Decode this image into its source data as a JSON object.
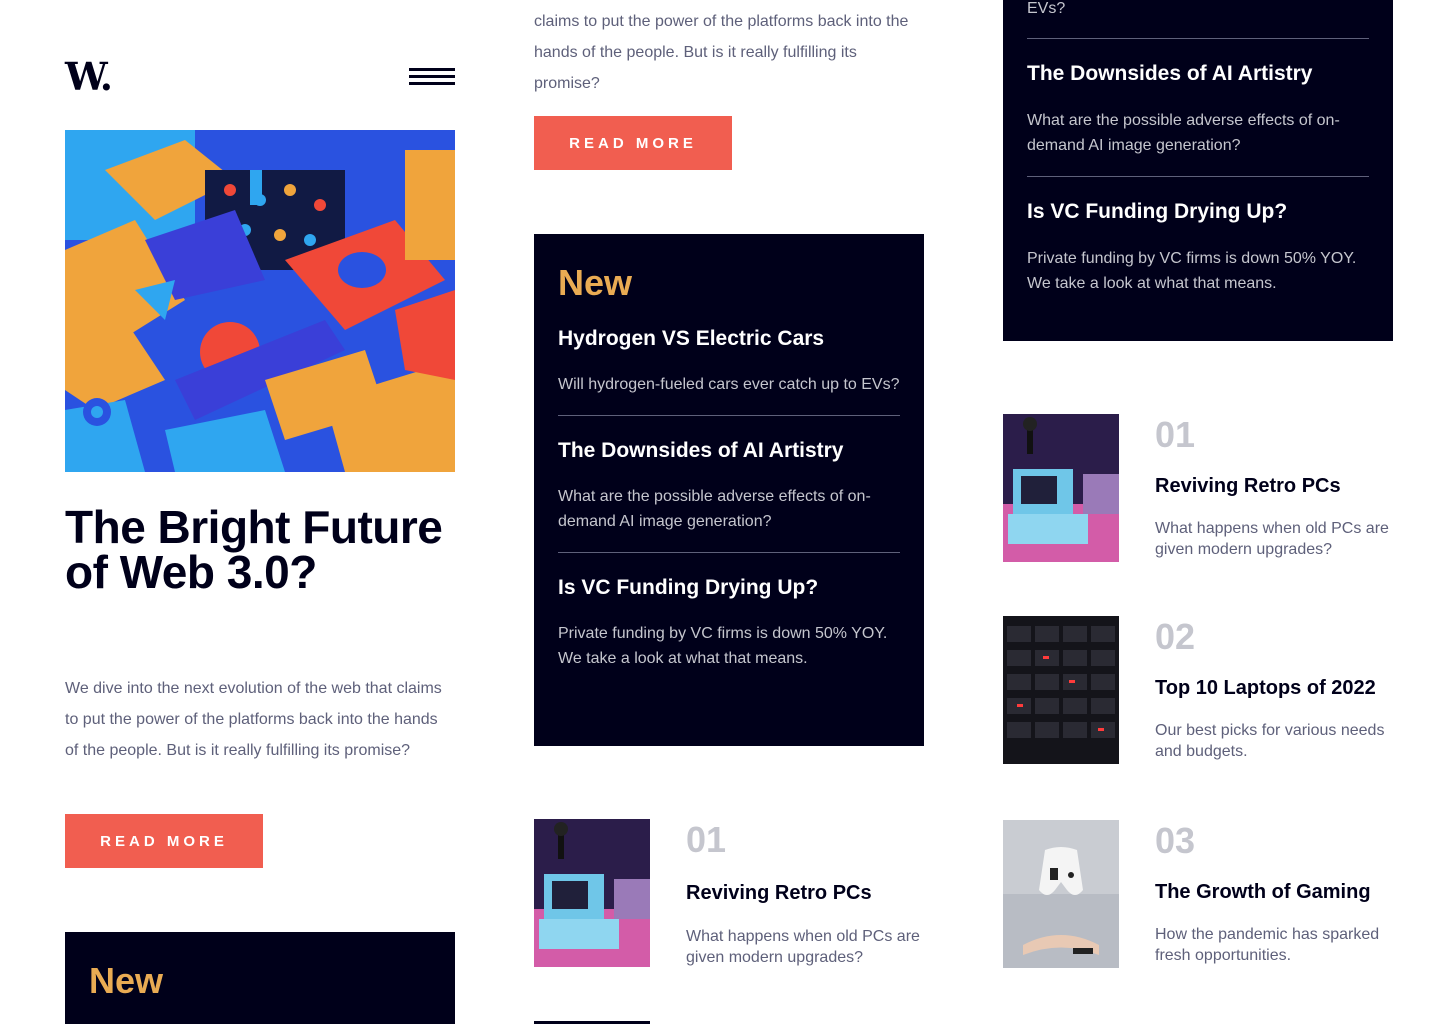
{
  "header": {
    "logo": "W.",
    "menu_icon": "hamburger-icon"
  },
  "hero": {
    "image_icon": "abstract-3d-blocks-image",
    "title": "The Bright Future of Web 3.0?",
    "description": "We dive into the next evolution of the web that claims to put the power of the platforms back into the hands of the people. But is it really fulfilling its promise?",
    "cta": "READ MORE"
  },
  "col1_new": {
    "title": "New"
  },
  "col2_hero": {
    "description": "claims to put the power of the platforms back into the hands of the people. But is it really fulfilling its promise?",
    "cta": "READ MORE"
  },
  "new_section": {
    "title": "New",
    "items": [
      {
        "title": "Hydrogen VS Electric Cars",
        "description": "Will hydrogen-fueled cars ever catch up to EVs?"
      },
      {
        "title": "The Downsides of AI Artistry",
        "description": "What are the possible adverse effects of on-demand AI image generation?"
      },
      {
        "title": "Is VC Funding Drying Up?",
        "description": "Private funding by VC firms is down 50% YOY. We take a look at what that means."
      }
    ]
  },
  "col3_new": {
    "cont_desc": "EVs?",
    "items": [
      {
        "title": "The Downsides of AI Artistry",
        "description": "What are the possible adverse effects of on-demand AI image generation?"
      },
      {
        "title": "Is VC Funding Drying Up?",
        "description": "Private funding by VC firms is down 50% YOY. We take a look at what that means."
      }
    ]
  },
  "ranked": [
    {
      "num": "01",
      "title": "Reviving Retro PCs",
      "description": "What happens when old PCs are given modern upgrades?",
      "icon": "retro-pc-image"
    },
    {
      "num": "02",
      "title": "Top 10 Laptops of 2022",
      "description": "Our best picks for various needs and budgets.",
      "icon": "laptop-keyboard-image"
    },
    {
      "num": "03",
      "title": "The Growth of Gaming",
      "description": "How the pandemic has sparked fresh opportunities.",
      "icon": "gamepad-image"
    }
  ],
  "colors": {
    "dark": "#00001a",
    "accent_red": "#f15e50",
    "accent_orange": "#e9ab53",
    "grey": "#5e607a",
    "light_grey": "#c5c6ce"
  }
}
